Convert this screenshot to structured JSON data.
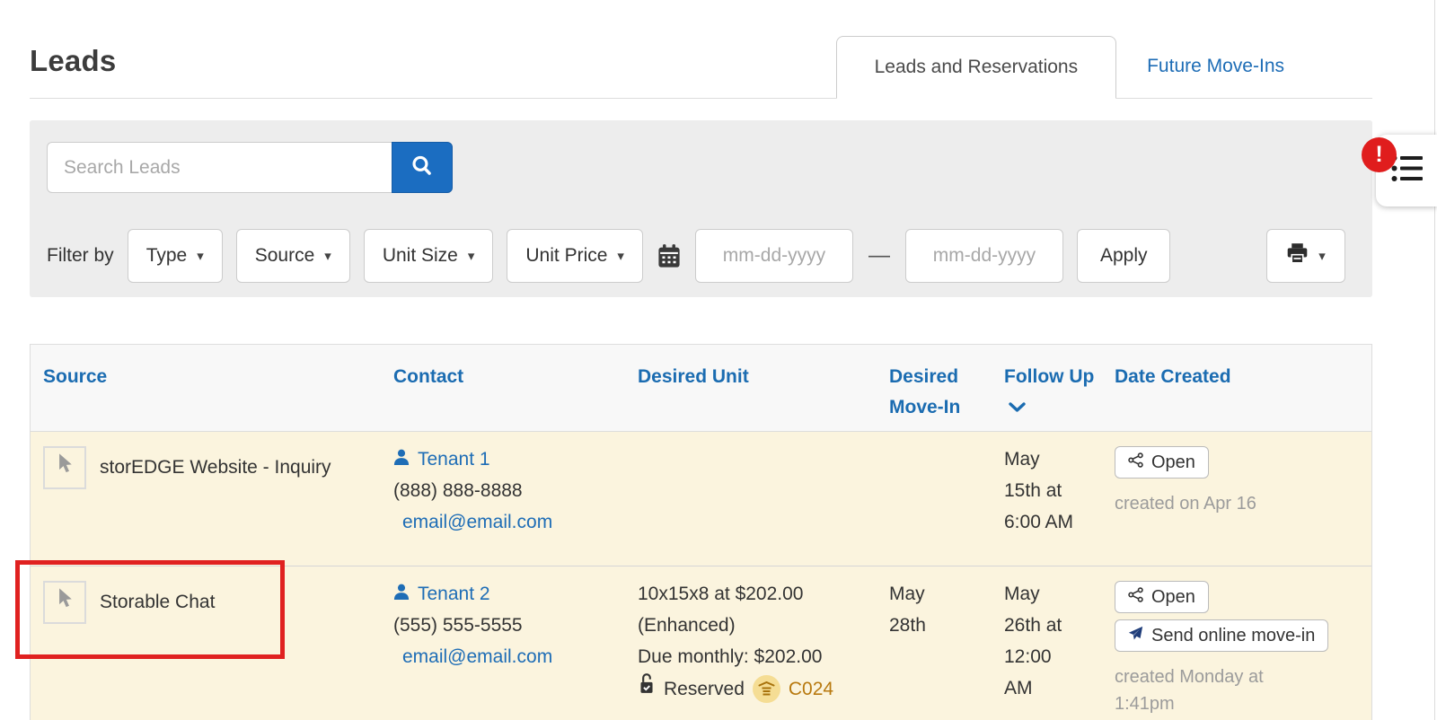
{
  "page": {
    "title": "Leads"
  },
  "tabs": {
    "leads_and_reservations": "Leads and Reservations",
    "future_move_ins": "Future Move-Ins"
  },
  "filter_bar": {
    "search_placeholder": "Search Leads",
    "filter_by": "Filter by",
    "type": "Type",
    "source": "Source",
    "unit_size": "Unit Size",
    "unit_price": "Unit Price",
    "date_from_placeholder": "mm-dd-yyyy",
    "date_to_placeholder": "mm-dd-yyyy",
    "range_separator": "—",
    "apply": "Apply"
  },
  "notification": {
    "badge": "!"
  },
  "table": {
    "headers": {
      "source": "Source",
      "contact": "Contact",
      "desired_unit": "Desired Unit",
      "desired_move_in": "Desired Move-In",
      "follow_up": "Follow Up",
      "date_created": "Date Created"
    },
    "rows": [
      {
        "source": "storEDGE Website - Inquiry",
        "contact": {
          "name": "Tenant 1",
          "phone": "(888) 888-8888",
          "email": "email@email.com"
        },
        "desired_unit": "",
        "desired_move_in": "",
        "follow_up": "May 15th at 6:00 AM",
        "actions": {
          "open": "Open"
        },
        "created": "created on Apr 16"
      },
      {
        "source": "Storable Chat",
        "contact": {
          "name": "Tenant 2",
          "phone": "(555) 555-5555",
          "email": "email@email.com"
        },
        "desired_unit": {
          "description": "10x15x8 at $202.00 (Enhanced)",
          "due": "Due monthly: $202.00",
          "status": "Reserved",
          "unit_number": "C024"
        },
        "desired_move_in": "May 28th",
        "follow_up": "May 26th at 12:00 AM",
        "actions": {
          "open": "Open",
          "send": "Send online move-in"
        },
        "created": "created Monday at 1:41pm"
      }
    ]
  },
  "icons": {
    "search": "magnifier-icon",
    "calendar": "calendar-icon",
    "print": "printer-icon",
    "dropdown_caret": "caret-down-icon",
    "sort": "chevron-down-icon",
    "cursor": "cursor-arrow-icon",
    "person": "person-icon",
    "open": "share-icon",
    "send": "paper-plane-icon",
    "lock": "lock-check-icon",
    "unit": "storage-unit-icon",
    "list": "list-icon",
    "alert": "alert-badge"
  },
  "colors": {
    "accent_blue": "#1b6dc1",
    "link_blue": "#1e6db6",
    "header_blue": "#1b6cb1",
    "row_highlight": "#fbf4de",
    "alert_red": "#e01d1d",
    "outline_red": "#e02120",
    "unit_gold_text": "#b8790f",
    "unit_gold_bg": "#f5dd94"
  }
}
